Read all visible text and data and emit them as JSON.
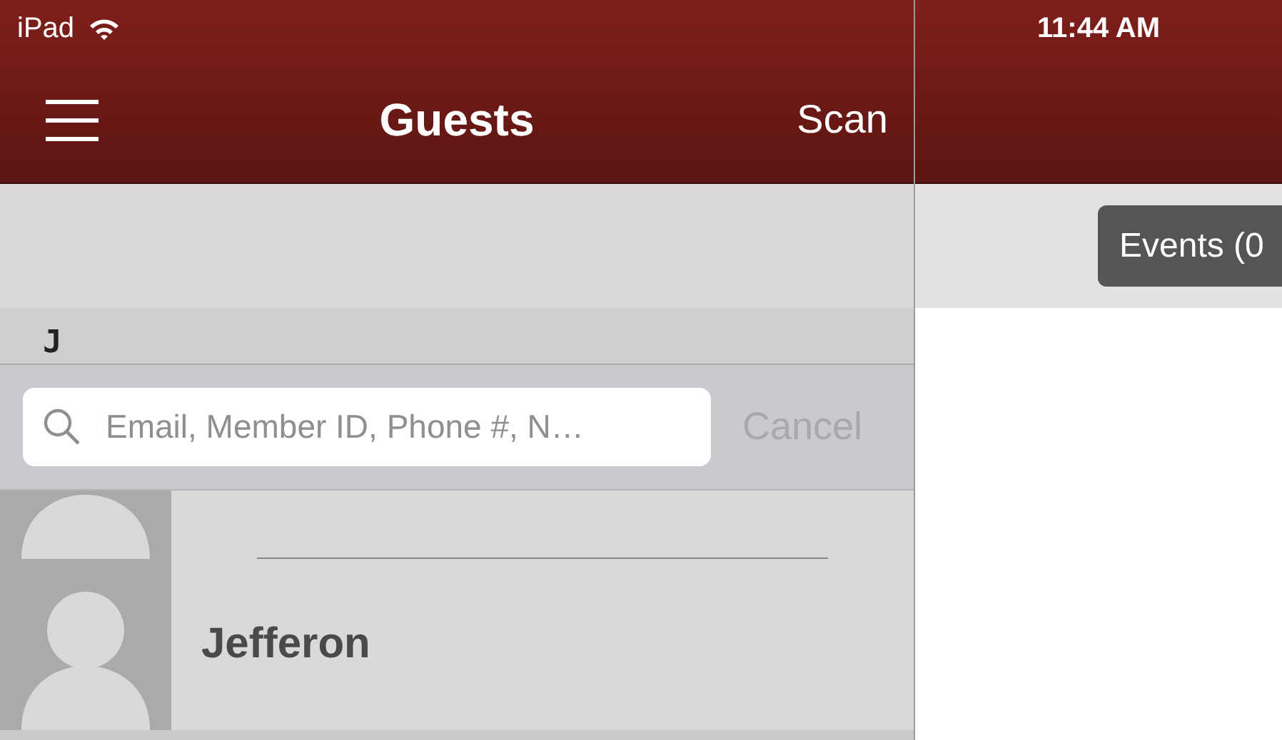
{
  "status_bar": {
    "device": "iPad",
    "time": "11:44 AM"
  },
  "nav_bar": {
    "title": "Guests",
    "action": "Scan"
  },
  "section_header": "J",
  "search": {
    "placeholder": "Email, Member ID, Phone #, N…",
    "cancel": "Cancel",
    "cancel_disabled": true
  },
  "guests": [
    {
      "name": "Jefferon"
    }
  ],
  "events_button": "Events (0"
}
